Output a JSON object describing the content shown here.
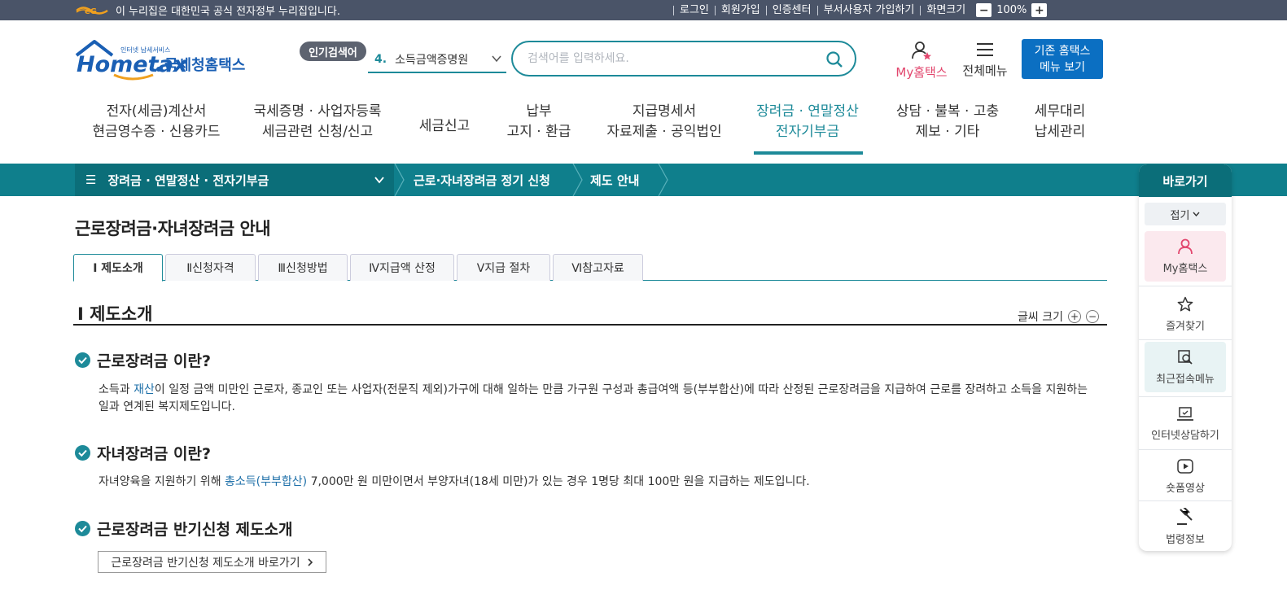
{
  "gov_banner": {
    "text": "이 누리집은 대한민국 공식 전자정부 누리집입니다.",
    "util_links": [
      "로그인",
      "회원가입",
      "인증센터",
      "부서사용자 가입하기",
      "화면크기"
    ],
    "zoom_minus": "−",
    "zoom_value": "100%",
    "zoom_plus": "+"
  },
  "header": {
    "logo_text": "국세청홈택스",
    "logo_sub": "인터넷 납세서비스",
    "popular_badge": "인기검색어",
    "popular_num": "4.",
    "popular_term": "소득금액증명원",
    "search_placeholder": "검색어를 입력하세요.",
    "my_hometax": "My홈택스",
    "all_menu": "전체메뉴",
    "legacy_line1": "기존 홈택스",
    "legacy_line2": "메뉴 보기"
  },
  "gnb": [
    {
      "line1": "전자(세금)계산서",
      "line2": "현금영수증 · 신용카드"
    },
    {
      "line1": "국세증명 · 사업자등록",
      "line2": "세금관련 신청/신고"
    },
    {
      "line1": "세금신고",
      "line2": ""
    },
    {
      "line1": "납부",
      "line2": "고지 · 환급"
    },
    {
      "line1": "지급명세서",
      "line2": "자료제출 · 공익법인"
    },
    {
      "line1": "장려금 · 연말정산",
      "line2": "전자기부금"
    },
    {
      "line1": "상담 · 불복 · 고충",
      "line2": "제보 · 기타"
    },
    {
      "line1": "세무대리",
      "line2": "납세관리"
    }
  ],
  "location": {
    "level1": "장려금 · 연말정산 · 전자기부금",
    "level2": "근로·자녀장려금 정기 신청",
    "level3": "제도 안내"
  },
  "page": {
    "title": "근로장려금·자녀장려금 안내",
    "tabs": [
      "Ⅰ 제도소개",
      "Ⅱ신청자격",
      "Ⅲ신청방법",
      "Ⅳ지급액 산정",
      "Ⅴ지급 절차",
      "Ⅵ참고자료"
    ],
    "section_title": "Ⅰ 제도소개",
    "font_size_label": "글씨 크기",
    "q1_title": "근로장려금 이란?",
    "q1_body_pre": "소득과 ",
    "q1_body_hl": "재산",
    "q1_body_post": "이 일정 금액 미만인 근로자, 종교인 또는 사업자(전문직 제외)가구에 대해 일하는 만큼 가구원 구성과 총급여액 등(부부합산)에 따라 산정된 근로장려금을 지급하여 근로를 장려하고 소득을 지원하는 일과 연계된 복지제도입니다.",
    "q2_title": "자녀장려금 이란?",
    "q2_body_pre": "자녀양육을 지원하기 위해 ",
    "q2_body_hl": "총소득(부부합산)",
    "q2_body_post": " 7,000만 원 미만이면서 부양자녀(18세 미만)가 있는 경우 1명당 최대 100만 원을 지급하는 제도입니다.",
    "q3_title": "근로장려금 반기신청 제도소개",
    "link_button": "근로장려금 반기신청 제도소개 바로가기"
  },
  "quick_menu": {
    "title": "바로가기",
    "fold": "접기",
    "items": [
      "My홈택스",
      "즐겨찾기",
      "최근접속메뉴",
      "인터넷상담하기",
      "숏폼영상",
      "법령정보"
    ]
  },
  "colors": {
    "teal": "#1d8a99",
    "loc_bar": "#0f7f8c",
    "loc_bar_dark": "#0b6e79",
    "gov_bar": "#4a5468",
    "legacy_blue": "#0b6fc2",
    "pink": "#e2466d"
  }
}
